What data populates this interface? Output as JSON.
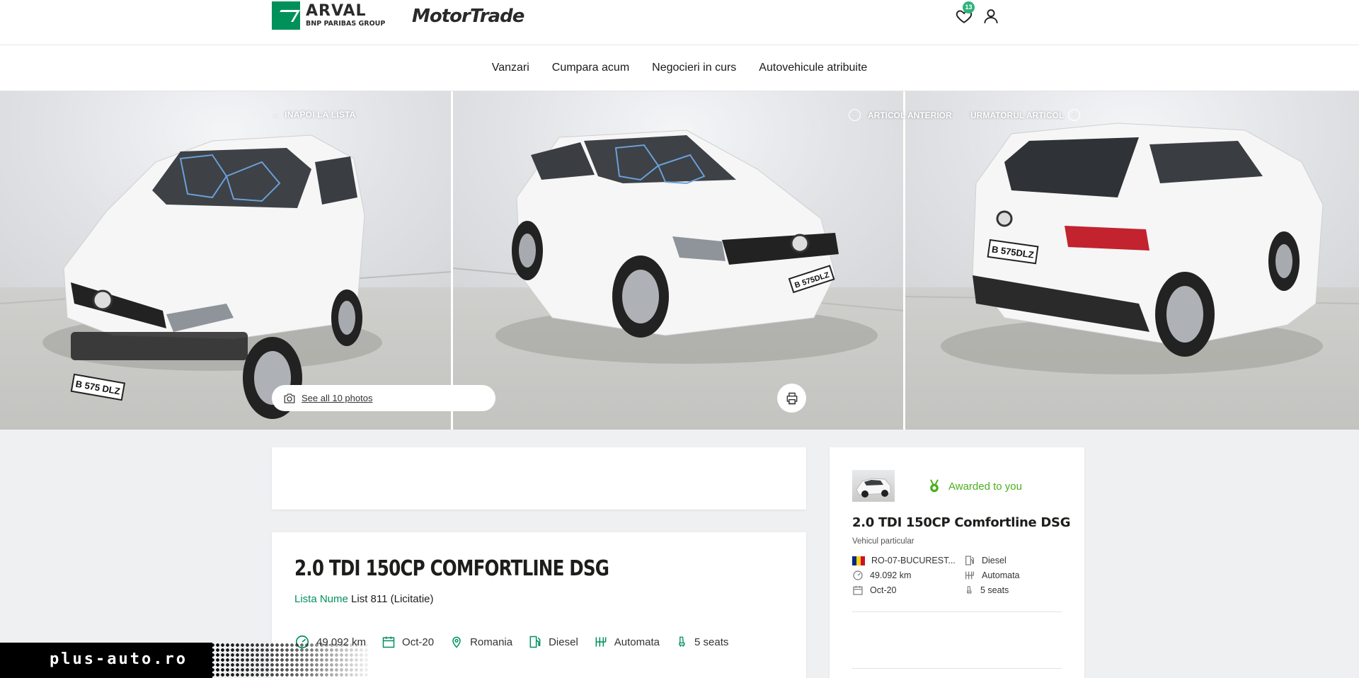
{
  "header": {
    "brand_name": "ARVAL",
    "brand_sub": "BNP PARIBAS GROUP",
    "partner_name": "MotorTrade",
    "favorites_count": "13"
  },
  "nav": {
    "items": [
      {
        "label": "Vanzari"
      },
      {
        "label": "Cumpara acum"
      },
      {
        "label": "Negocieri in curs"
      },
      {
        "label": "Autovehicule atribuite"
      }
    ]
  },
  "gallery": {
    "back_label": "INAPOI LA LISTA",
    "prev_label": "ARTICOL ANTERIOR",
    "next_label": "URMATORUL ARTICOL",
    "see_all_label": "See all 10 photos",
    "plate": "B 575 DLZ"
  },
  "vehicle": {
    "title": "2.0 TDI 150CP COMFORTLINE DSG",
    "list_label": "Lista Nume",
    "list_value": "List 811 (Licitatie)",
    "specs": {
      "mileage": "49.092 km",
      "date": "Oct-20",
      "country": "Romania",
      "fuel": "Diesel",
      "gearbox": "Automata",
      "seats": "5 seats"
    }
  },
  "side": {
    "awarded_label": "Awarded to you",
    "title": "2.0 TDI 150CP Comfortline DSG",
    "subtitle": "Vehicul particular",
    "location": "RO-07-BUCUREST...",
    "fuel": "Diesel",
    "mileage": "49.092 km",
    "gearbox": "Automata",
    "date": "Oct-20",
    "seats": "5 seats"
  },
  "watermark": {
    "text": "plus-auto.ro"
  },
  "colors": {
    "brand_green": "#00915a",
    "awarded_green": "#4caf1f",
    "badge_green": "#2fb37a",
    "page_bg": "#eef0f2"
  }
}
